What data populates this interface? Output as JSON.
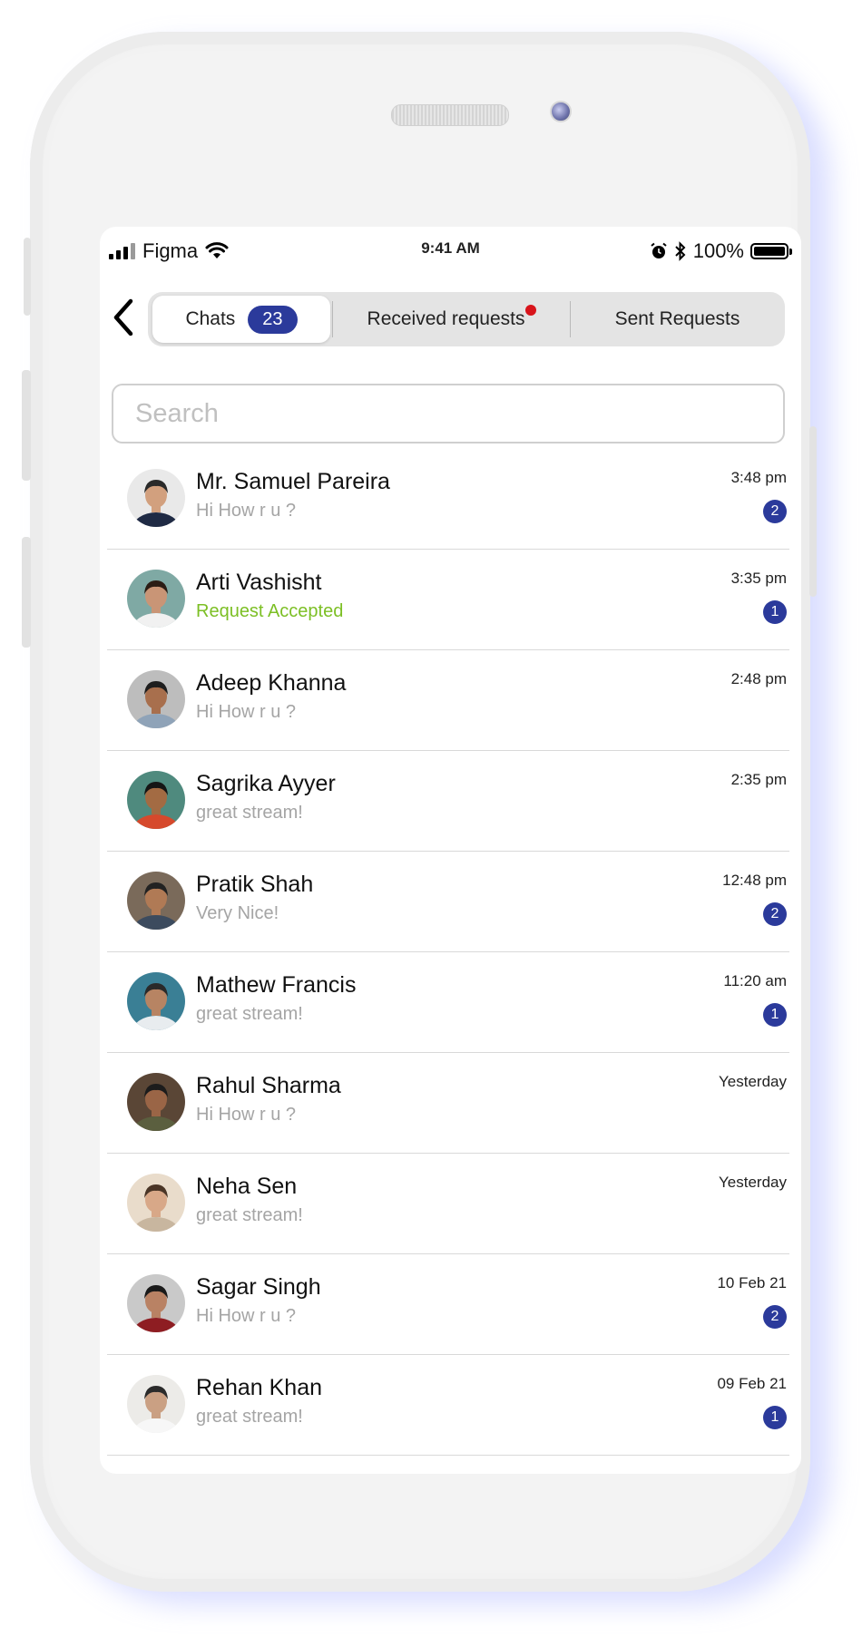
{
  "status_bar": {
    "carrier": "Figma",
    "time": "9:41 AM",
    "battery": "100%"
  },
  "tabs": {
    "chats_label": "Chats",
    "chats_count": "23",
    "received_label": "Received requests",
    "sent_label": "Sent Requests"
  },
  "search": {
    "placeholder": "Search",
    "value": ""
  },
  "colors": {
    "accent": "#2b3a9b",
    "status_green": "#7cbf24",
    "notification_dot": "#d8141b"
  },
  "chats": [
    {
      "name": "Mr. Samuel Pareira",
      "message": "Hi How r u ?",
      "time": "3:48 pm",
      "unread": "2",
      "avatar": "avatar-photo"
    },
    {
      "name": "Arti Vashisht",
      "message": "Request Accepted",
      "time": "3:35 pm",
      "unread": "1",
      "avatar": "avatar-photo"
    },
    {
      "name": "Adeep Khanna",
      "message": "Hi How r u ?",
      "time": "2:48 pm",
      "unread": "",
      "avatar": "avatar-photo"
    },
    {
      "name": "Sagrika Ayyer",
      "message": "great stream!",
      "time": "2:35 pm",
      "unread": "",
      "avatar": "avatar-photo"
    },
    {
      "name": "Pratik Shah",
      "message": "Very Nice!",
      "time": "12:48 pm",
      "unread": "2",
      "avatar": "avatar-photo"
    },
    {
      "name": "Mathew Francis",
      "message": "great stream!",
      "time": "11:20 am",
      "unread": "1",
      "avatar": "avatar-photo"
    },
    {
      "name": "Rahul Sharma",
      "message": "Hi How r u ?",
      "time": "Yesterday",
      "unread": "",
      "avatar": "avatar-photo"
    },
    {
      "name": "Neha Sen",
      "message": "great stream!",
      "time": "Yesterday",
      "unread": "",
      "avatar": "avatar-photo"
    },
    {
      "name": "Sagar Singh",
      "message": "Hi How r u ?",
      "time": "10 Feb 21",
      "unread": "2",
      "avatar": "avatar-photo"
    },
    {
      "name": "Rehan Khan",
      "message": "great stream!",
      "time": "09 Feb 21",
      "unread": "1",
      "avatar": "avatar-photo"
    }
  ]
}
